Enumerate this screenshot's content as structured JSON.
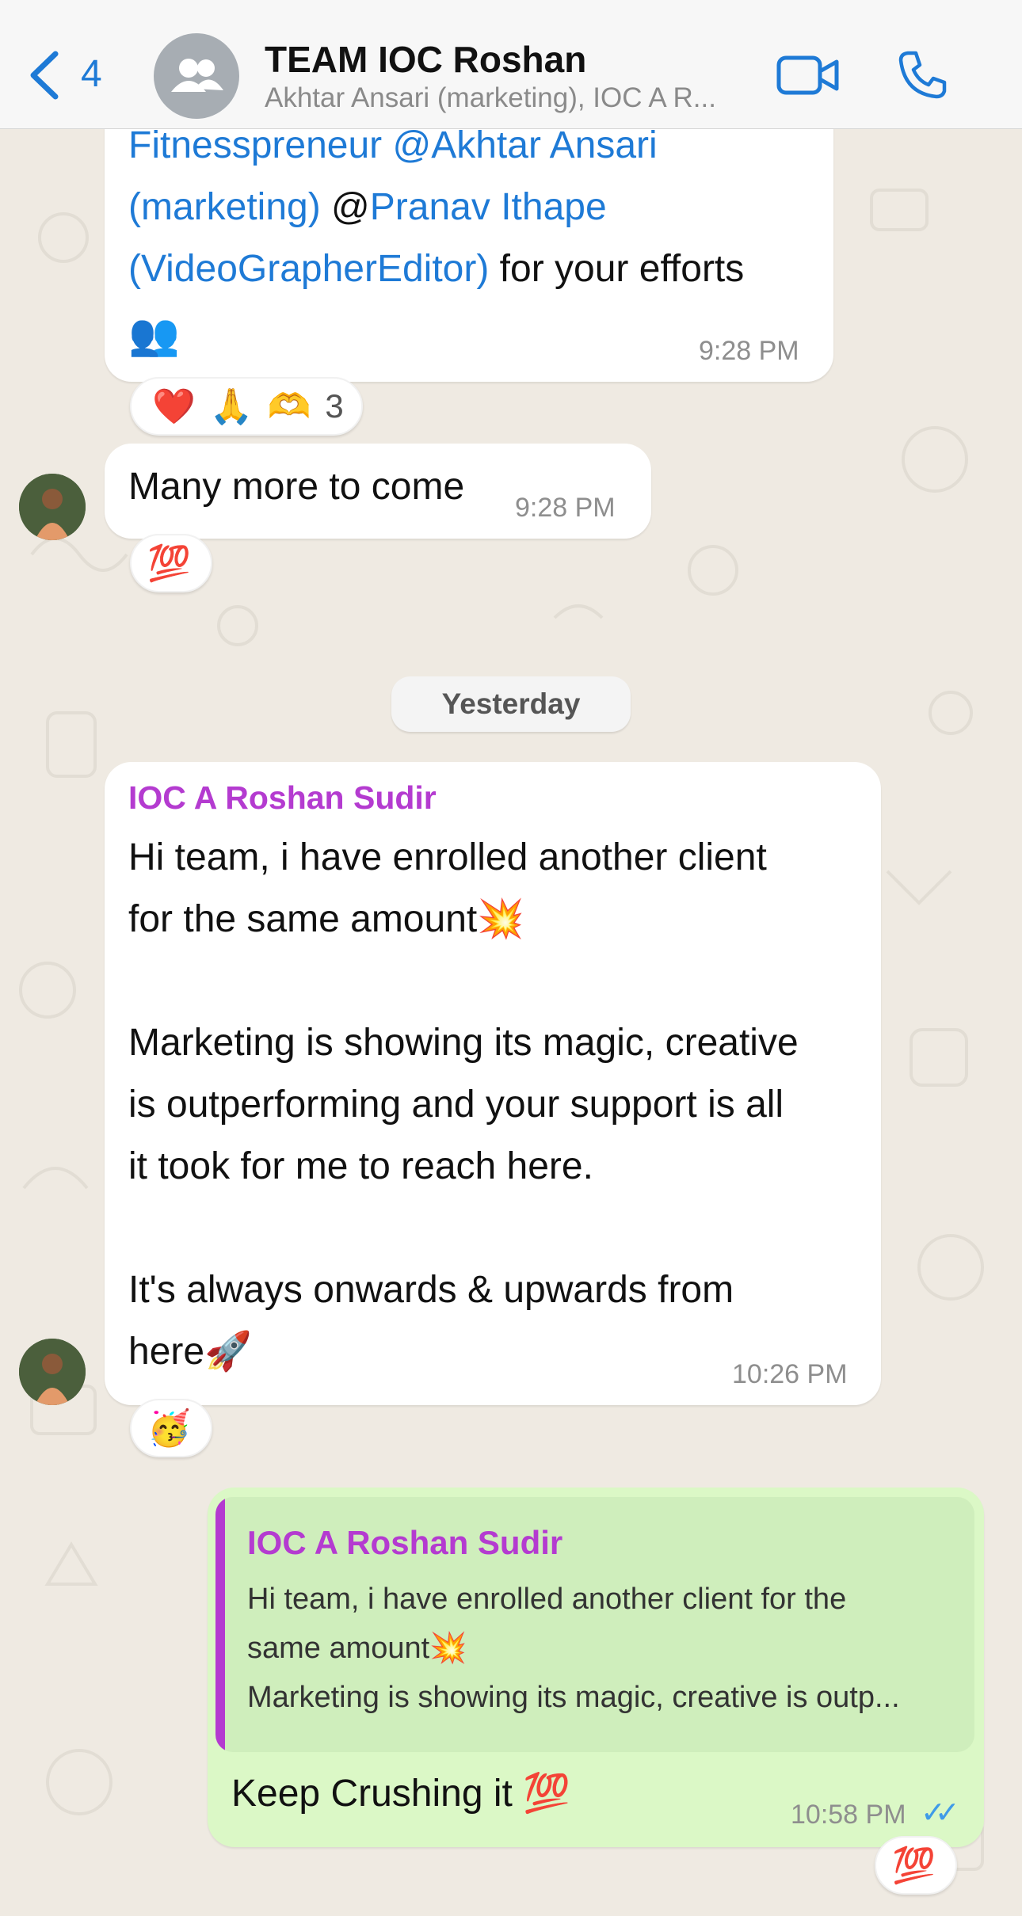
{
  "header": {
    "back_count": "4",
    "title": "TEAM IOC Roshan",
    "subtitle": "Akhtar Ansari (marketing), IOC A R...",
    "icons": [
      "chevron-left-icon",
      "group-avatar-icon",
      "video-call-icon",
      "phone-icon"
    ]
  },
  "messages": [
    {
      "lines": [
        "Fitnesspreneur @Akhtar Ansari",
        "(marketing) @Pranav Ithape",
        "(VideoGrapherEditor) for your efforts"
      ],
      "mention_1": "Fitnesspreneur @Akhtar Ansari",
      "mention_2": "(marketing)",
      "at_sign": " @",
      "mention_3": "Pranav Ithape",
      "mention_4": "(VideoGrapherEditor)",
      "tail": " for your efforts",
      "trailing_emoji": "👥",
      "time": "9:28 PM",
      "reactions": [
        "❤️",
        "🙏",
        "🫶",
        "3"
      ]
    },
    {
      "text": "Many more to come",
      "time": "9:28 PM",
      "reaction": "💯"
    }
  ],
  "date_separator": "Yesterday",
  "message_3": {
    "sender": "IOC A Roshan Sudir",
    "line1": "Hi team, i have enrolled another client",
    "line2": "for the same amount💥",
    "line3": "Marketing is showing its magic, creative",
    "line4": "is outperforming and your support is all",
    "line5": "it took for me to reach here.",
    "line6": "It's always onwards & upwards from",
    "line7": "here🚀",
    "time": "10:26 PM",
    "reaction": "🥳"
  },
  "message_4": {
    "quote_sender": "IOC A Roshan Sudir",
    "quote_line1": "Hi team, i have enrolled another client for the",
    "quote_line2": "same amount💥",
    "quote_line3": "Marketing is showing its magic, creative is outp...",
    "text": "Keep Crushing it 💯",
    "time": "10:58 PM",
    "read_receipt": "✓✓",
    "reaction": "💯"
  },
  "colors": {
    "accent": "#1e7ad6",
    "sender": "#b43bd0",
    "out_bubble": "#dbf8c6",
    "chat_bg": "#efeae2"
  }
}
